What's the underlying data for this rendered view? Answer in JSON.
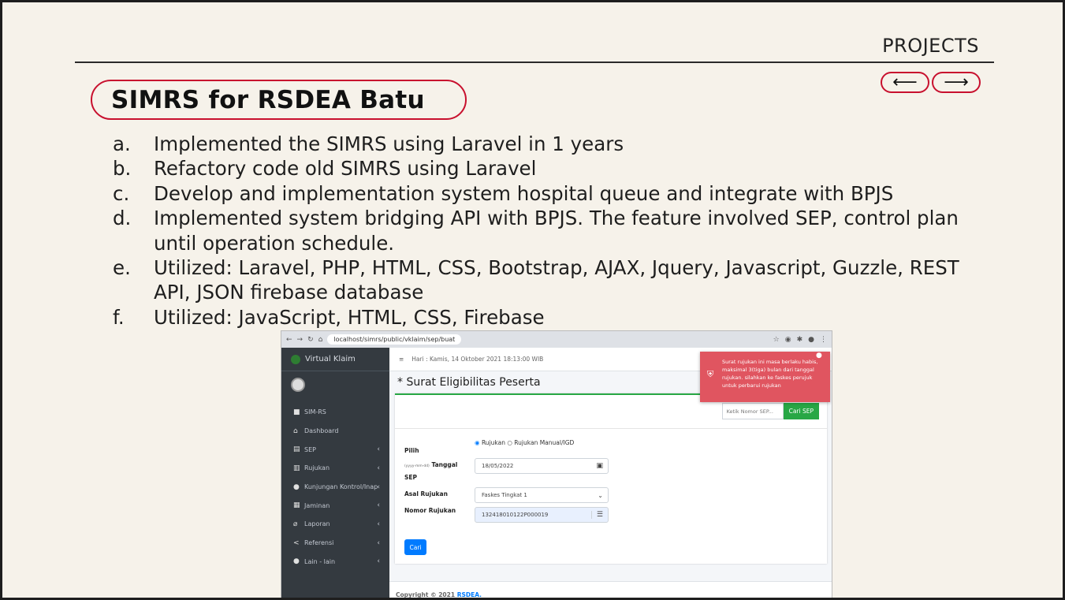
{
  "section_label": "PROJECTS",
  "nav": {
    "prev": "⟵",
    "next": "⟶"
  },
  "title": "SIMRS for RSDEA Batu",
  "points": [
    {
      "marker": "a.",
      "text": "Implemented the SIMRS using Laravel in 1 years"
    },
    {
      "marker": "b.",
      "text": "Refactory code old SIMRS using Laravel"
    },
    {
      "marker": "c.",
      "text": "Develop and implementation system hospital queue and integrate with BPJS"
    },
    {
      "marker": "d.",
      "text": "Implemented system bridging API with BPJS. The feature involved SEP, control plan until operation schedule."
    },
    {
      "marker": "e.",
      "text": "Utilized: Laravel, PHP, HTML, CSS, Bootstrap, AJAX, Jquery, Javascript, Guzzle, REST API, JSON firebase database"
    },
    {
      "marker": "f.",
      "text": "Utilized: JavaScript, HTML, CSS, Firebase"
    }
  ],
  "screenshot": {
    "url": "localhost/simrs/public/vklaim/sep/buat",
    "brand": "Virtual Klaim",
    "menu": [
      {
        "icon": "■",
        "label": "SIM-RS",
        "chev": ""
      },
      {
        "icon": "⌂",
        "label": "Dashboard",
        "chev": ""
      },
      {
        "icon": "▤",
        "label": "SEP",
        "chev": "‹"
      },
      {
        "icon": "▥",
        "label": "Rujukan",
        "chev": "‹"
      },
      {
        "icon": "●",
        "label": "Kunjungan Kontrol/Inap",
        "chev": "‹"
      },
      {
        "icon": "▦",
        "label": "Jaminan",
        "chev": "‹"
      },
      {
        "icon": "⌀",
        "label": "Laporan",
        "chev": "‹"
      },
      {
        "icon": "<",
        "label": "Referensi",
        "chev": "‹"
      },
      {
        "icon": "●",
        "label": "Lain - lain",
        "chev": "‹"
      }
    ],
    "date_text": "Hari : Kamis, 14 Oktober 2021 18:13:00 WIB",
    "page_title": "* Surat Eligibilitas Peserta",
    "search_placeholder": "Ketik Nomor SEP...",
    "search_button": "Cari SEP",
    "pilih_label": "Pilih",
    "radio_1": "Rujukan",
    "radio_2": "Rujukan Manual/IGD",
    "date_hint": "(yyyy-mm-dd)",
    "tanggal_label": "Tanggal",
    "sep_label": "SEP",
    "tanggal_value": "18/05/2022",
    "asal_label": "Asal Rujukan",
    "asal_value": "Faskes Tingkat 1",
    "nomor_label": "Nomor Rujukan",
    "nomor_value": "132418010122P000019",
    "cari_button": "Cari",
    "footer_text": "Copyright © 2021",
    "footer_link": "RSDEA.",
    "toast_text": "Surat rujukan ini masa berlaku habis, maksimal 3(tiga) bulan dari tanggal rujukan. silahkan ke faskes perujuk untuk perbarui rujukan"
  }
}
